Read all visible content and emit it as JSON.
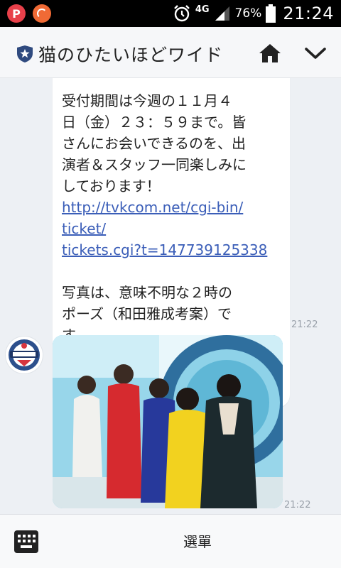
{
  "status_bar": {
    "network": "4G",
    "battery": "76%",
    "time": "21:24",
    "icons": [
      "p-app-icon",
      "notification-app-icon",
      "alarm-icon",
      "signal-icon",
      "battery-icon"
    ]
  },
  "header": {
    "title": "猫のひたいほどワイド",
    "icons": [
      "shield-star-icon",
      "home-icon",
      "chevron-down-icon"
    ]
  },
  "chat": {
    "message": {
      "lines": [
        "受付期間は今週の１１月４",
        "日（金）２３：５９まで。皆",
        "さんにお会いできるのを、出",
        "演者＆スタッフ一同楽しみに",
        "しております！"
      ],
      "link_lines": [
        "http://tvkcom.net/cgi-bin/",
        "ticket/",
        "tickets.cgi?t=147739125338"
      ],
      "closing_lines": [
        "写真は、意味不明な２時の",
        "ポーズ（和田雅成考案）で",
        "す。"
      ],
      "timestamp": "21:22"
    },
    "photo": {
      "timestamp": "21:22"
    }
  },
  "bottom_bar": {
    "menu_label": "選單",
    "icons": [
      "keyboard-icon"
    ]
  },
  "colors": {
    "link": "#3b5eb8",
    "chat_background": "#edf0f4",
    "header_background": "#f6f7f9",
    "shield_icon": "#2f4a7f"
  }
}
